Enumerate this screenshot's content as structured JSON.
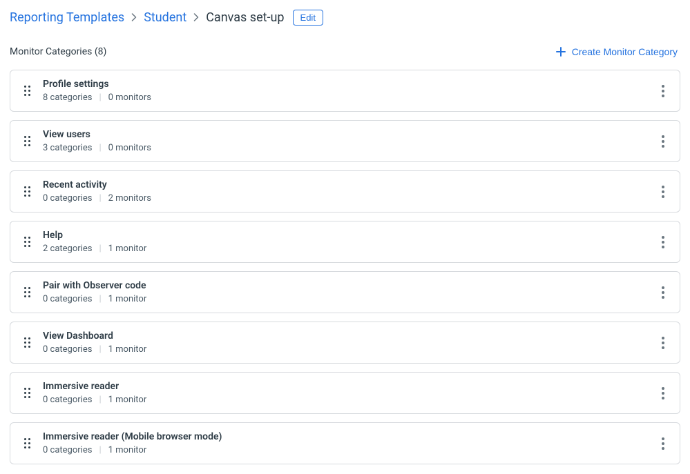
{
  "breadcrumb": {
    "items": [
      {
        "label": "Reporting Templates"
      },
      {
        "label": "Student"
      }
    ],
    "current": "Canvas set-up",
    "edit_label": "Edit"
  },
  "header": {
    "title": "Monitor Categories (8)",
    "create_label": "Create Monitor Category"
  },
  "categories": [
    {
      "title": "Profile settings",
      "categories_text": "8 categories",
      "monitors_text": "0 monitors"
    },
    {
      "title": "View users",
      "categories_text": "3 categories",
      "monitors_text": "0 monitors"
    },
    {
      "title": "Recent activity",
      "categories_text": "0 categories",
      "monitors_text": "2 monitors"
    },
    {
      "title": "Help",
      "categories_text": "2 categories",
      "monitors_text": "1 monitor"
    },
    {
      "title": "Pair with Observer code",
      "categories_text": "0 categories",
      "monitors_text": "1 monitor"
    },
    {
      "title": "View Dashboard",
      "categories_text": "0 categories",
      "monitors_text": "1 monitor"
    },
    {
      "title": "Immersive reader",
      "categories_text": "0 categories",
      "monitors_text": "1 monitor"
    },
    {
      "title": "Immersive reader (Mobile browser mode)",
      "categories_text": "0 categories",
      "monitors_text": "1 monitor"
    }
  ]
}
